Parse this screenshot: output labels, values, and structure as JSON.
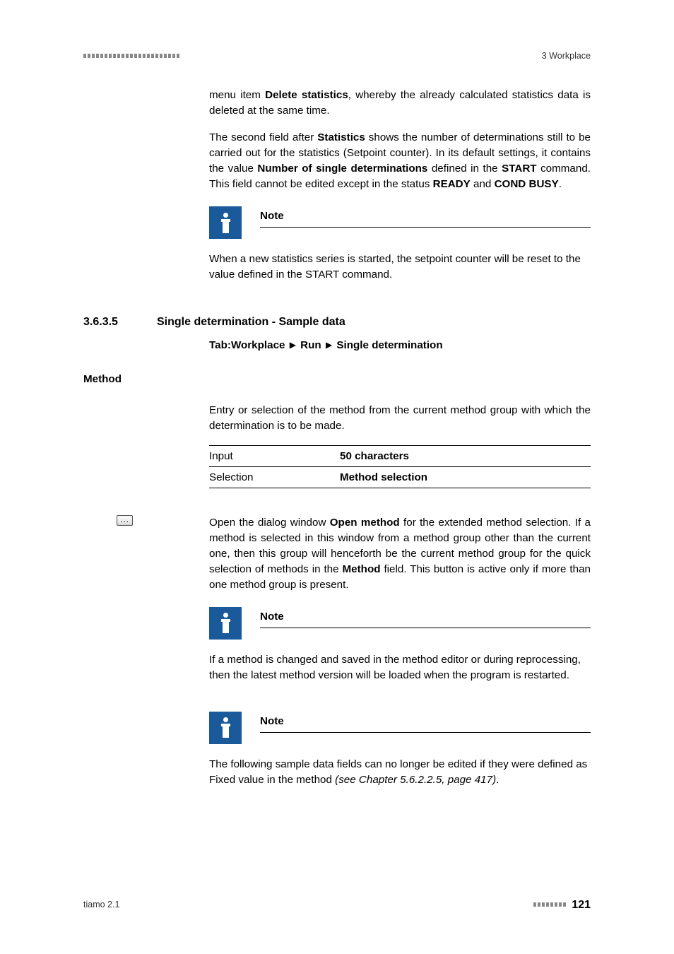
{
  "header": {
    "chapter": "3 Workplace"
  },
  "para1": {
    "t1": "menu item ",
    "b1": "Delete statistics",
    "t2": ", whereby the already calculated statistics data is deleted at the same time."
  },
  "para2": {
    "t1": "The second field after ",
    "b1": "Statistics",
    "t2": " shows the number of determinations still to be carried out for the statistics (Setpoint counter). In its default settings, it contains the value ",
    "b2": "Number of single determinations",
    "t3": " defined in the ",
    "b3": "START",
    "t4": " command. This field cannot be edited except in the status ",
    "b4": "READY",
    "t5": " and ",
    "b5": "COND BUSY",
    "t6": "."
  },
  "note1": {
    "title": "Note",
    "t1": "When a new statistics series is started, the setpoint counter will be reset to the value defined in the ",
    "b1": "START",
    "t2": " command."
  },
  "section": {
    "number": "3.6.3.5",
    "title": "Single determination - Sample data"
  },
  "breadcrumb": {
    "prefix": "Tab:",
    "p1": "Workplace",
    "p2": "Run",
    "p3": "Single determination"
  },
  "method": {
    "heading": "Method",
    "desc": "Entry or selection of the method from the current method group with which the determination is to be made.",
    "row1_label": "Input",
    "row1_value": "50 characters",
    "row2_label": "Selection",
    "row2_value": "Method selection"
  },
  "ellipsis_button": "...",
  "open_method_para": {
    "t1": "Open the dialog window ",
    "b1": "Open method",
    "t2": " for the extended method selection. If a method is selected in this window from a method group other than the current one, then this group will henceforth be the current method group for the quick selection of methods in the ",
    "b2": "Method",
    "t3": " field. This button is active only if more than one method group is present."
  },
  "note2": {
    "title": "Note",
    "body": "If a method is changed and saved in the method editor or during reprocessing, then the latest method version will be loaded when the program is restarted."
  },
  "note3": {
    "title": "Note",
    "t1": "The following sample data fields can no longer be edited if they were defined as ",
    "b1": "Fixed value",
    "t2": " in the method ",
    "i1": "(see Chapter 5.6.2.2.5, page 417)",
    "t3": "."
  },
  "footer": {
    "product": "tiamo 2.1",
    "page": "121"
  }
}
